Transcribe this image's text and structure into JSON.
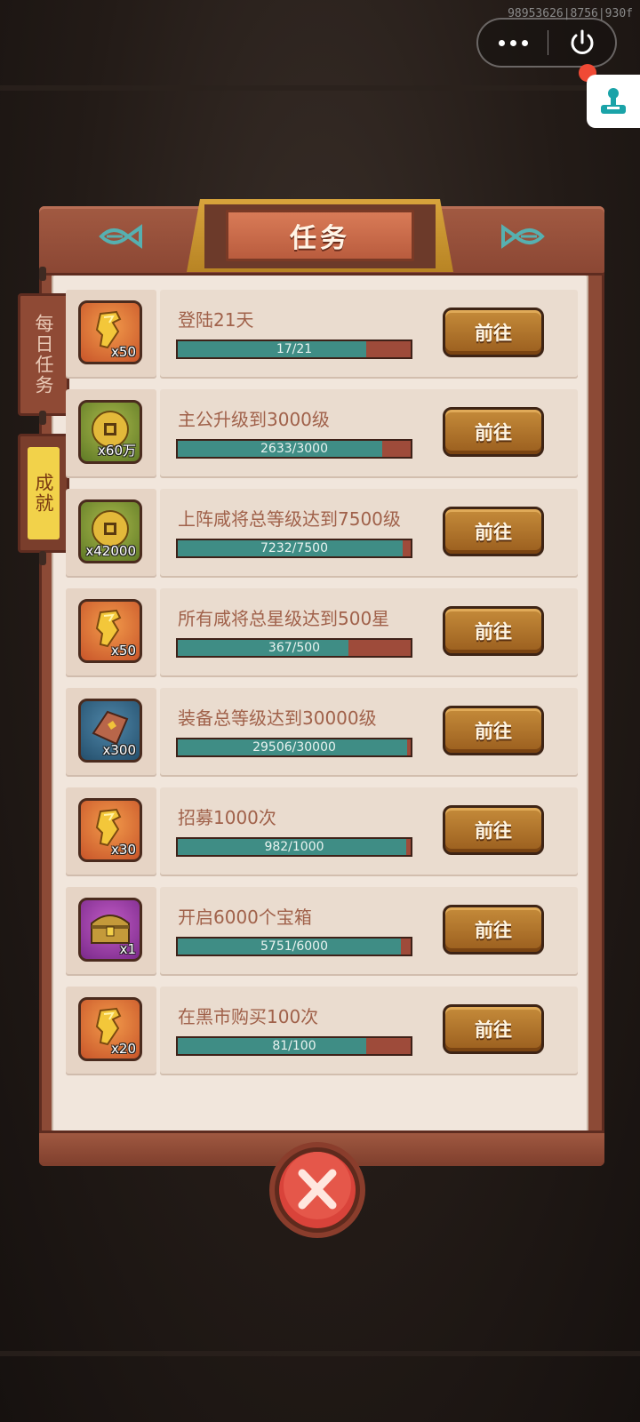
{
  "debug_id": "98953626|8756|930f",
  "title": "任务",
  "tabs": [
    {
      "label": "每日任务"
    },
    {
      "label": "成就"
    }
  ],
  "go_label": "前往",
  "tasks": [
    {
      "title": "登陆21天",
      "progress_text": "17/21",
      "current": 17,
      "total": 21,
      "reward_qty": "x50",
      "reward_icon": "gold-token-icon",
      "reward_color": "orange"
    },
    {
      "title": "主公升级到3000级",
      "progress_text": "2633/3000",
      "current": 2633,
      "total": 3000,
      "reward_qty": "x60万",
      "reward_icon": "coin-icon",
      "reward_color": "green"
    },
    {
      "title": "上阵咸将总等级达到7500级",
      "progress_text": "7232/7500",
      "current": 7232,
      "total": 7500,
      "reward_qty": "x42000",
      "reward_icon": "coin-icon",
      "reward_color": "green"
    },
    {
      "title": "所有咸将总星级达到500星",
      "progress_text": "367/500",
      "current": 367,
      "total": 500,
      "reward_qty": "x50",
      "reward_icon": "gold-token-icon",
      "reward_color": "orange"
    },
    {
      "title": "装备总等级达到30000级",
      "progress_text": "29506/30000",
      "current": 29506,
      "total": 30000,
      "reward_qty": "x300",
      "reward_icon": "whetstone-icon",
      "reward_color": "blue"
    },
    {
      "title": "招募1000次",
      "progress_text": "982/1000",
      "current": 982,
      "total": 1000,
      "reward_qty": "x30",
      "reward_icon": "gold-token-icon",
      "reward_color": "orange"
    },
    {
      "title": "开启6000个宝箱",
      "progress_text": "5751/6000",
      "current": 5751,
      "total": 6000,
      "reward_qty": "x1",
      "reward_icon": "treasure-chest-icon",
      "reward_color": "purple"
    },
    {
      "title": "在黑市购买100次",
      "progress_text": "81/100",
      "current": 81,
      "total": 100,
      "reward_qty": "x20",
      "reward_icon": "gold-token-icon",
      "reward_color": "orange"
    }
  ],
  "colors": {
    "panel_wood": "#8c4a36",
    "progress_fill": "#3f8d85",
    "progress_empty": "#9e4b3a",
    "button_gold": "#c58b3a",
    "close_red": "#d9433a"
  }
}
